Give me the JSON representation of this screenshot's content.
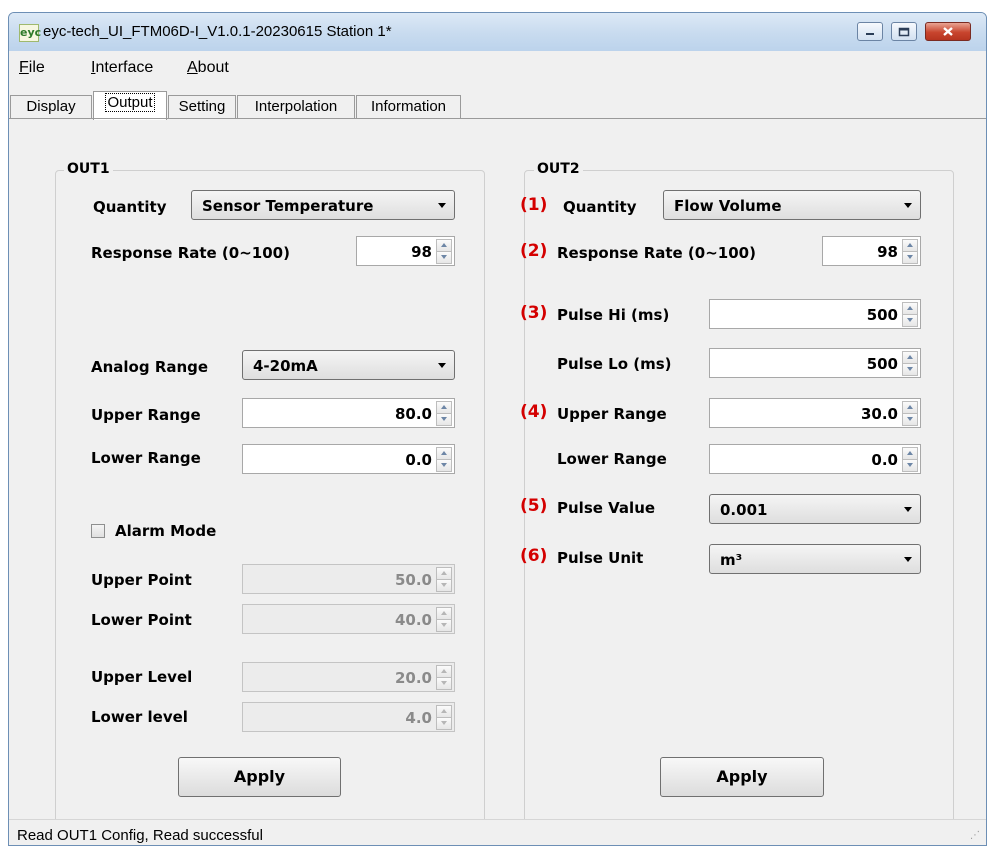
{
  "window": {
    "title": "eyc-tech_UI_FTM06D-I_V1.0.1-20230615  Station 1*",
    "app_icon_text": "eyc",
    "accent_color": "#d40000"
  },
  "menu": {
    "file": "File",
    "interface": "Interface",
    "about": "About"
  },
  "tabs": [
    "Display",
    "Output",
    "Setting",
    "Interpolation",
    "Information"
  ],
  "active_tab": "Output",
  "out1": {
    "title": "OUT1",
    "quantity_label": "Quantity",
    "quantity_value": "Sensor Temperature",
    "response_label": "Response Rate (0~100)",
    "response_value": "98",
    "analog_label": "Analog Range",
    "analog_value": "4-20mA",
    "upper_range_label": "Upper Range",
    "upper_range_value": "80.0",
    "lower_range_label": "Lower Range",
    "lower_range_value": "0.0",
    "alarm_label": "Alarm Mode",
    "alarm_checked": false,
    "upper_point_label": "Upper Point",
    "upper_point_value": "50.0",
    "lower_point_label": "Lower Point",
    "lower_point_value": "40.0",
    "upper_level_label": "Upper Level",
    "upper_level_value": "20.0",
    "lower_level_label": "Lower level",
    "lower_level_value": "4.0",
    "apply_label": "Apply"
  },
  "out2": {
    "title": "OUT2",
    "markers": [
      "(1)",
      "(2)",
      "(3)",
      "(4)",
      "(5)",
      "(6)"
    ],
    "quantity_label": "Quantity",
    "quantity_value": "Flow Volume",
    "response_label": "Response Rate (0~100)",
    "response_value": "98",
    "pulse_hi_label": "Pulse Hi (ms)",
    "pulse_hi_value": "500",
    "pulse_lo_label": "Pulse Lo (ms)",
    "pulse_lo_value": "500",
    "upper_range_label": "Upper Range",
    "upper_range_value": "30.0",
    "lower_range_label": "Lower Range",
    "lower_range_value": "0.0",
    "pulse_value_label": "Pulse Value",
    "pulse_value_value": "0.001",
    "pulse_unit_label": "Pulse Unit",
    "pulse_unit_value": "m³",
    "apply_label": "Apply"
  },
  "status": {
    "text": "Read OUT1 Config,   Read successful"
  }
}
